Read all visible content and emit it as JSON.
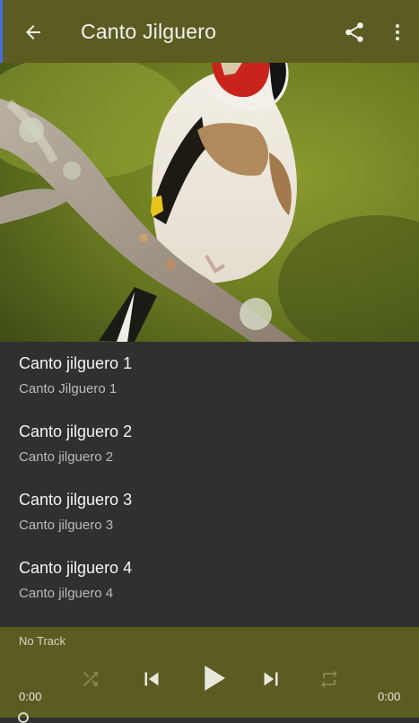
{
  "app_bar": {
    "title": "Canto Jilguero",
    "icons": {
      "back": "arrow-back-icon",
      "share": "share-icon",
      "more": "more-vertical-icon"
    }
  },
  "hero_image": {
    "subject": "goldfinch-on-branch"
  },
  "tracks": [
    {
      "title": "Canto jilguero 1",
      "subtitle": "Canto Jilguero 1"
    },
    {
      "title": "Canto jilguero 2",
      "subtitle": "Canto jilguero 2"
    },
    {
      "title": "Canto jilguero 3",
      "subtitle": "Canto jilguero 3"
    },
    {
      "title": "Canto jilguero 4",
      "subtitle": "Canto jilguero 4"
    }
  ],
  "player": {
    "now_playing": "No Track",
    "elapsed": "0:00",
    "duration": "0:00",
    "progress": 0,
    "controls": [
      "shuffle-icon",
      "skip-previous-icon",
      "play-icon",
      "skip-next-icon",
      "repeat-icon"
    ]
  },
  "colors": {
    "primary": "#5b5c22",
    "background": "#303030",
    "text_primary": "#f4f4f4",
    "text_secondary": "#b9b9b9",
    "accent": "#c8241c"
  }
}
